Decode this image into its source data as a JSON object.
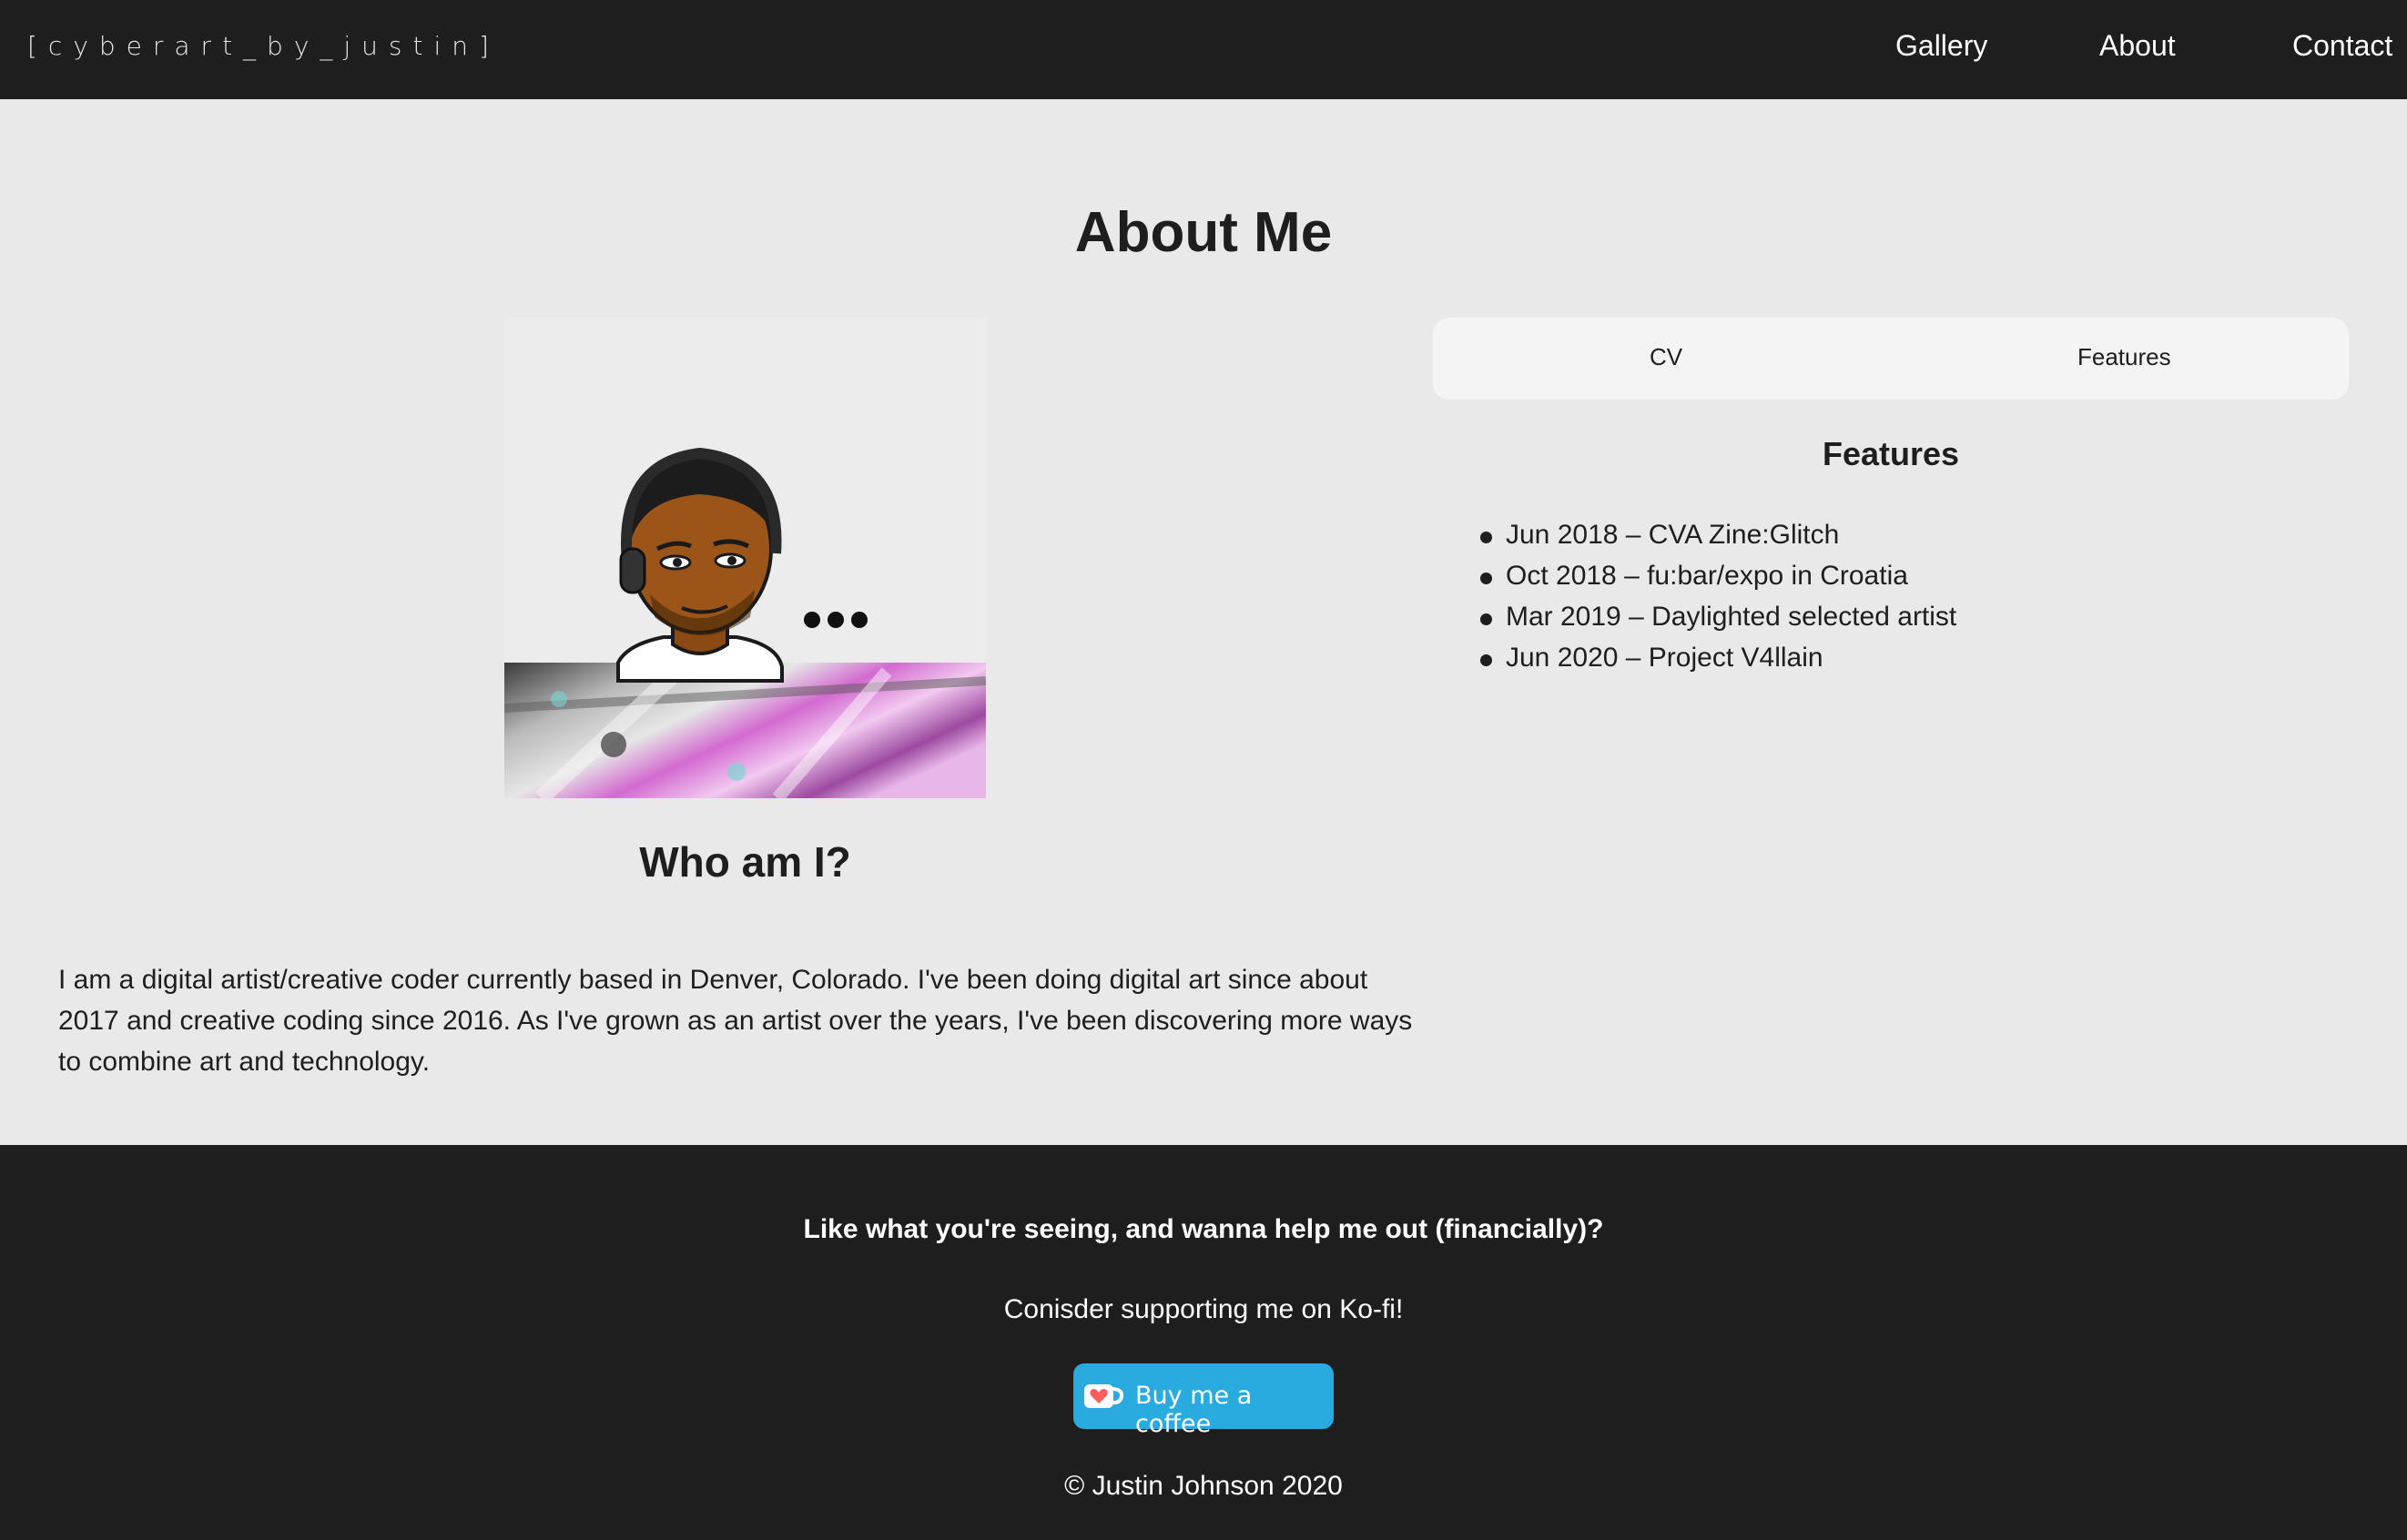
{
  "header": {
    "brand": "[cyberart_by_justin]",
    "nav": [
      {
        "label": "Gallery"
      },
      {
        "label": "About"
      },
      {
        "label": "Contact"
      }
    ]
  },
  "main": {
    "title": "About Me",
    "profile": {
      "image_icon": "bitmoji-avatar-with-headphones",
      "heading": "Who am I?",
      "bio": "I am a digital artist/creative coder currently based in Denver, Colorado. I've been doing digital art since about 2017 and creative coding since 2016. As I've grown as an artist over the years, I've been discovering more ways to combine art and technology."
    },
    "tabs": [
      {
        "label": "CV"
      },
      {
        "label": "Features"
      }
    ],
    "active_tab": "Features",
    "panel": {
      "heading": "Features",
      "items": [
        "Jun 2018 – CVA Zine:Glitch",
        "Oct 2018 – fu:bar/expo in Croatia",
        "Mar 2019 – Daylighted selected artist",
        "Jun 2020 – Project V4llain"
      ]
    }
  },
  "footer": {
    "heading": "Like what you're seeing, and wanna help me out (financially)?",
    "subtext": "Conisder supporting me on Ko-fi!",
    "kofi_button": {
      "label": "Buy me a coffee",
      "icon": "kofi-cup-heart-icon"
    },
    "copyright": "© Justin Johnson 2020"
  },
  "colors": {
    "header_bg": "#1e1e1e",
    "page_bg": "#e9e9e9",
    "footer_bg": "#1e1e1e",
    "kofi_blue": "#29abe0",
    "text_dark": "#1e1e1e"
  }
}
